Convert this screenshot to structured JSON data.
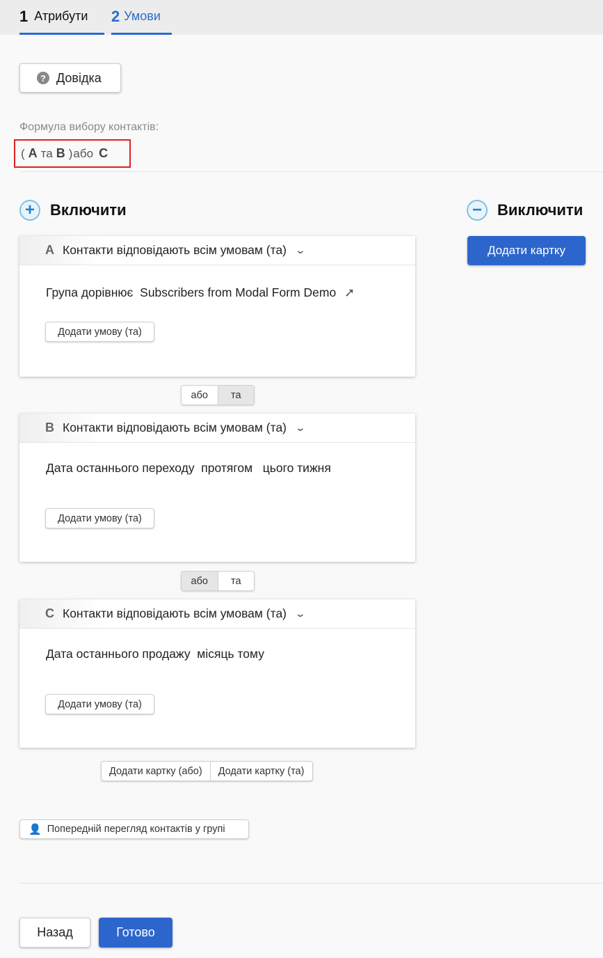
{
  "tabs": [
    {
      "num": "1",
      "label": "Атрибути"
    },
    {
      "num": "2",
      "label": "Умови"
    }
  ],
  "help_button": {
    "label": "Довідка",
    "icon": "question-circle-icon"
  },
  "formula": {
    "label": "Формула вибору контактів:",
    "tokens": [
      "(",
      "A",
      "та",
      "B",
      ")",
      "або",
      "C"
    ]
  },
  "include": {
    "title": "Включити",
    "icon": "plus-circle-icon"
  },
  "exclude": {
    "title": "Виключити",
    "icon": "minus-circle-icon",
    "add_card": "Додати картку"
  },
  "cards": [
    {
      "letter": "A",
      "title": "Контакти відповідають всім умовам (та)",
      "condition": "Група дорівнює  Subscribers from Modal Form Demo",
      "add_condition": "Додати умову (та)"
    },
    {
      "letter": "B",
      "title": "Контакти відповідають всім умовам (та)",
      "condition": "Дата останнього переходу  протягом   цього тижня",
      "add_condition": "Додати умову (та)"
    },
    {
      "letter": "C",
      "title": "Контакти відповідають всім умовам (та)",
      "condition": "Дата останнього продажу  місяць тому",
      "add_condition": "Додати умову (та)"
    }
  ],
  "connectors": [
    {
      "or": "або",
      "and": "та",
      "selected": "та"
    },
    {
      "or": "або",
      "and": "та",
      "selected": "або"
    }
  ],
  "bottom_add": {
    "or": "Додати картку (або)",
    "and": "Додати картку (та)"
  },
  "preview_button": "Попередній перегляд контактів у групі",
  "footer": {
    "back": "Назад",
    "done": "Готово"
  },
  "colors": {
    "accent": "#2c66cc",
    "highlight_border": "#e02020"
  }
}
